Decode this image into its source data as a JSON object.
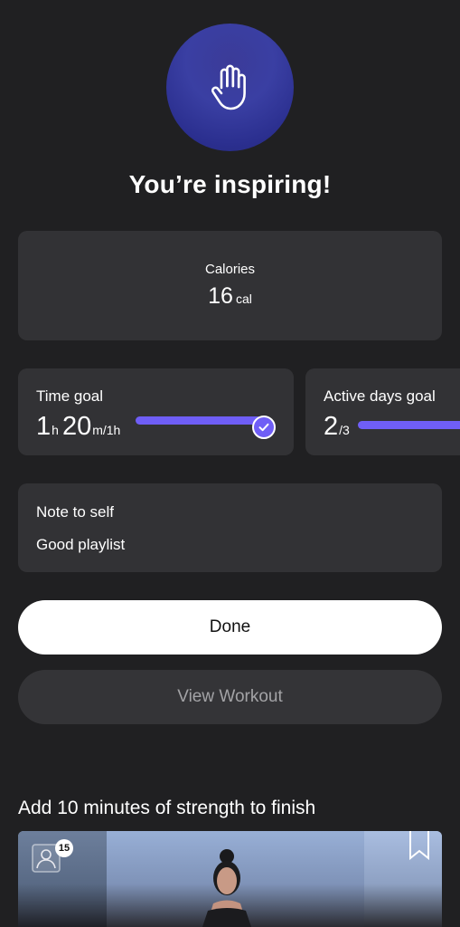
{
  "header": {
    "badge_icon": "raised-hand-icon",
    "headline": "You’re inspiring!"
  },
  "calories": {
    "label": "Calories",
    "value": "16",
    "unit": "cal"
  },
  "time_goal": {
    "title": "Time goal",
    "hours": "1",
    "hours_unit": "h",
    "minutes": "20",
    "minutes_unit": "m",
    "target": "/1h",
    "progress": 1.0,
    "completed_icon": "checkmark-icon"
  },
  "active_days_goal": {
    "title": "Active days goal",
    "value": "2",
    "target": "/3",
    "progress": 0.67
  },
  "note": {
    "title": "Note to self",
    "text": "Good playlist"
  },
  "actions": {
    "done_label": "Done",
    "view_workout_label": "View Workout"
  },
  "recommendation": {
    "title": "Add 10 minutes of strength to finish",
    "participant_count": "15",
    "participants_icon": "person-icon",
    "bookmark_icon": "bookmark-icon"
  },
  "colors": {
    "background": "#202022",
    "card": "#323235",
    "accent": "#6f5ef6",
    "badge": "#3a3fa3"
  }
}
